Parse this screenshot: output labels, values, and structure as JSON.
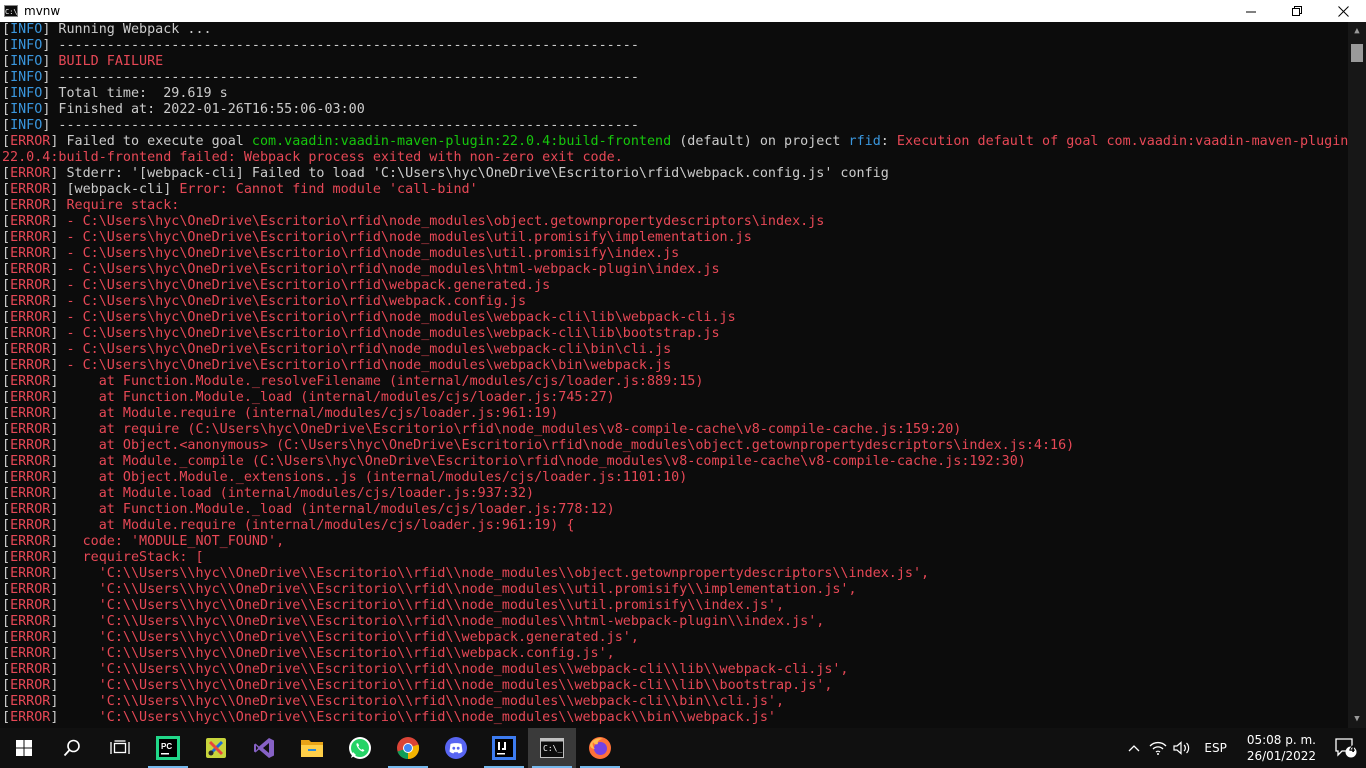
{
  "window": {
    "title": "mvnw",
    "icon_label": "C:\\"
  },
  "colors": {
    "info_tag": "#3a96dd",
    "error_tag": "#e74856",
    "default_text": "#cccccc",
    "green": "#16c60c",
    "background": "#0c0c0c",
    "taskbar": "#101010"
  },
  "terminal": {
    "lines": [
      {
        "tag": "INFO",
        "segs": [
          {
            "t": " Running Webpack ...",
            "c": "white"
          }
        ]
      },
      {
        "tag": "INFO",
        "segs": [
          {
            "t": " ------------------------------------------------------------------------",
            "c": "white"
          }
        ]
      },
      {
        "tag": "INFO",
        "segs": [
          {
            "t": " BUILD FAILURE",
            "c": "red"
          }
        ]
      },
      {
        "tag": "INFO",
        "segs": [
          {
            "t": " ------------------------------------------------------------------------",
            "c": "white"
          }
        ]
      },
      {
        "tag": "INFO",
        "segs": [
          {
            "t": " Total time:  29.619 s",
            "c": "white"
          }
        ]
      },
      {
        "tag": "INFO",
        "segs": [
          {
            "t": " Finished at: 2022-01-26T16:55:06-03:00",
            "c": "white"
          }
        ]
      },
      {
        "tag": "INFO",
        "segs": [
          {
            "t": " ------------------------------------------------------------------------",
            "c": "white"
          }
        ]
      },
      {
        "tag": "ERROR",
        "segs": [
          {
            "t": " Failed to execute goal ",
            "c": "white"
          },
          {
            "t": "com.vaadin:vaadin-maven-plugin:22.0.4:build-frontend",
            "c": "green"
          },
          {
            "t": " (default)",
            "c": "white"
          },
          {
            "t": " on project ",
            "c": "white"
          },
          {
            "t": "rfid",
            "c": "cyan"
          },
          {
            "t": ": ",
            "c": "white"
          },
          {
            "t": "Execution default of goal com.vaadin:vaadin-maven-plugin:",
            "c": "red"
          }
        ]
      },
      {
        "tag": "",
        "segs": [
          {
            "t": "22.0.4:build-frontend failed: Webpack process exited with non-zero exit code.",
            "c": "red"
          }
        ]
      },
      {
        "tag": "ERROR",
        "segs": [
          {
            "t": " Stderr: '[webpack-cli] Failed to load 'C:\\Users\\hyc\\OneDrive\\Escritorio\\rfid\\webpack.config.js' config",
            "c": "white"
          }
        ]
      },
      {
        "tag": "ERROR",
        "segs": [
          {
            "t": " [webpack-cli] ",
            "c": "white"
          },
          {
            "t": "Error: Cannot find module 'call-bind'",
            "c": "red"
          }
        ]
      },
      {
        "tag": "ERROR",
        "segs": [
          {
            "t": " Require stack:",
            "c": "red"
          }
        ]
      },
      {
        "tag": "ERROR",
        "segs": [
          {
            "t": " - C:\\Users\\hyc\\OneDrive\\Escritorio\\rfid\\node_modules\\object.getownpropertydescriptors\\index.js",
            "c": "red"
          }
        ]
      },
      {
        "tag": "ERROR",
        "segs": [
          {
            "t": " - C:\\Users\\hyc\\OneDrive\\Escritorio\\rfid\\node_modules\\util.promisify\\implementation.js",
            "c": "red"
          }
        ]
      },
      {
        "tag": "ERROR",
        "segs": [
          {
            "t": " - C:\\Users\\hyc\\OneDrive\\Escritorio\\rfid\\node_modules\\util.promisify\\index.js",
            "c": "red"
          }
        ]
      },
      {
        "tag": "ERROR",
        "segs": [
          {
            "t": " - C:\\Users\\hyc\\OneDrive\\Escritorio\\rfid\\node_modules\\html-webpack-plugin\\index.js",
            "c": "red"
          }
        ]
      },
      {
        "tag": "ERROR",
        "segs": [
          {
            "t": " - C:\\Users\\hyc\\OneDrive\\Escritorio\\rfid\\webpack.generated.js",
            "c": "red"
          }
        ]
      },
      {
        "tag": "ERROR",
        "segs": [
          {
            "t": " - C:\\Users\\hyc\\OneDrive\\Escritorio\\rfid\\webpack.config.js",
            "c": "red"
          }
        ]
      },
      {
        "tag": "ERROR",
        "segs": [
          {
            "t": " - C:\\Users\\hyc\\OneDrive\\Escritorio\\rfid\\node_modules\\webpack-cli\\lib\\webpack-cli.js",
            "c": "red"
          }
        ]
      },
      {
        "tag": "ERROR",
        "segs": [
          {
            "t": " - C:\\Users\\hyc\\OneDrive\\Escritorio\\rfid\\node_modules\\webpack-cli\\lib\\bootstrap.js",
            "c": "red"
          }
        ]
      },
      {
        "tag": "ERROR",
        "segs": [
          {
            "t": " - C:\\Users\\hyc\\OneDrive\\Escritorio\\rfid\\node_modules\\webpack-cli\\bin\\cli.js",
            "c": "red"
          }
        ]
      },
      {
        "tag": "ERROR",
        "segs": [
          {
            "t": " - C:\\Users\\hyc\\OneDrive\\Escritorio\\rfid\\node_modules\\webpack\\bin\\webpack.js",
            "c": "red"
          }
        ]
      },
      {
        "tag": "ERROR",
        "segs": [
          {
            "t": "     at Function.Module._resolveFilename (internal/modules/cjs/loader.js:889:15)",
            "c": "red"
          }
        ]
      },
      {
        "tag": "ERROR",
        "segs": [
          {
            "t": "     at Function.Module._load (internal/modules/cjs/loader.js:745:27)",
            "c": "red"
          }
        ]
      },
      {
        "tag": "ERROR",
        "segs": [
          {
            "t": "     at Module.require (internal/modules/cjs/loader.js:961:19)",
            "c": "red"
          }
        ]
      },
      {
        "tag": "ERROR",
        "segs": [
          {
            "t": "     at require (C:\\Users\\hyc\\OneDrive\\Escritorio\\rfid\\node_modules\\v8-compile-cache\\v8-compile-cache.js:159:20)",
            "c": "red"
          }
        ]
      },
      {
        "tag": "ERROR",
        "segs": [
          {
            "t": "     at Object.<anonymous> (C:\\Users\\hyc\\OneDrive\\Escritorio\\rfid\\node_modules\\object.getownpropertydescriptors\\index.js:4:16)",
            "c": "red"
          }
        ]
      },
      {
        "tag": "ERROR",
        "segs": [
          {
            "t": "     at Module._compile (C:\\Users\\hyc\\OneDrive\\Escritorio\\rfid\\node_modules\\v8-compile-cache\\v8-compile-cache.js:192:30)",
            "c": "red"
          }
        ]
      },
      {
        "tag": "ERROR",
        "segs": [
          {
            "t": "     at Object.Module._extensions..js (internal/modules/cjs/loader.js:1101:10)",
            "c": "red"
          }
        ]
      },
      {
        "tag": "ERROR",
        "segs": [
          {
            "t": "     at Module.load (internal/modules/cjs/loader.js:937:32)",
            "c": "red"
          }
        ]
      },
      {
        "tag": "ERROR",
        "segs": [
          {
            "t": "     at Function.Module._load (internal/modules/cjs/loader.js:778:12)",
            "c": "red"
          }
        ]
      },
      {
        "tag": "ERROR",
        "segs": [
          {
            "t": "     at Module.require (internal/modules/cjs/loader.js:961:19) {",
            "c": "red"
          }
        ]
      },
      {
        "tag": "ERROR",
        "segs": [
          {
            "t": "   code: 'MODULE_NOT_FOUND',",
            "c": "red"
          }
        ]
      },
      {
        "tag": "ERROR",
        "segs": [
          {
            "t": "   requireStack: [",
            "c": "red"
          }
        ]
      },
      {
        "tag": "ERROR",
        "segs": [
          {
            "t": "     'C:\\\\Users\\\\hyc\\\\OneDrive\\\\Escritorio\\\\rfid\\\\node_modules\\\\object.getownpropertydescriptors\\\\index.js',",
            "c": "red"
          }
        ]
      },
      {
        "tag": "ERROR",
        "segs": [
          {
            "t": "     'C:\\\\Users\\\\hyc\\\\OneDrive\\\\Escritorio\\\\rfid\\\\node_modules\\\\util.promisify\\\\implementation.js',",
            "c": "red"
          }
        ]
      },
      {
        "tag": "ERROR",
        "segs": [
          {
            "t": "     'C:\\\\Users\\\\hyc\\\\OneDrive\\\\Escritorio\\\\rfid\\\\node_modules\\\\util.promisify\\\\index.js',",
            "c": "red"
          }
        ]
      },
      {
        "tag": "ERROR",
        "segs": [
          {
            "t": "     'C:\\\\Users\\\\hyc\\\\OneDrive\\\\Escritorio\\\\rfid\\\\node_modules\\\\html-webpack-plugin\\\\index.js',",
            "c": "red"
          }
        ]
      },
      {
        "tag": "ERROR",
        "segs": [
          {
            "t": "     'C:\\\\Users\\\\hyc\\\\OneDrive\\\\Escritorio\\\\rfid\\\\webpack.generated.js',",
            "c": "red"
          }
        ]
      },
      {
        "tag": "ERROR",
        "segs": [
          {
            "t": "     'C:\\\\Users\\\\hyc\\\\OneDrive\\\\Escritorio\\\\rfid\\\\webpack.config.js',",
            "c": "red"
          }
        ]
      },
      {
        "tag": "ERROR",
        "segs": [
          {
            "t": "     'C:\\\\Users\\\\hyc\\\\OneDrive\\\\Escritorio\\\\rfid\\\\node_modules\\\\webpack-cli\\\\lib\\\\webpack-cli.js',",
            "c": "red"
          }
        ]
      },
      {
        "tag": "ERROR",
        "segs": [
          {
            "t": "     'C:\\\\Users\\\\hyc\\\\OneDrive\\\\Escritorio\\\\rfid\\\\node_modules\\\\webpack-cli\\\\lib\\\\bootstrap.js',",
            "c": "red"
          }
        ]
      },
      {
        "tag": "ERROR",
        "segs": [
          {
            "t": "     'C:\\\\Users\\\\hyc\\\\OneDrive\\\\Escritorio\\\\rfid\\\\node_modules\\\\webpack-cli\\\\bin\\\\cli.js',",
            "c": "red"
          }
        ]
      },
      {
        "tag": "ERROR",
        "segs": [
          {
            "t": "     'C:\\\\Users\\\\hyc\\\\OneDrive\\\\Escritorio\\\\rfid\\\\node_modules\\\\webpack\\\\bin\\\\webpack.js'",
            "c": "red"
          }
        ]
      }
    ]
  },
  "taskbar": {
    "items": [
      {
        "name": "windows-start-icon",
        "active": false,
        "running": false
      },
      {
        "name": "search-icon",
        "active": false,
        "running": false
      },
      {
        "name": "task-view-icon",
        "active": false,
        "running": false
      },
      {
        "name": "pycharm-icon",
        "active": false,
        "running": true
      },
      {
        "name": "scissors-image-app-icon",
        "active": false,
        "running": false
      },
      {
        "name": "visual-studio-icon",
        "active": false,
        "running": false
      },
      {
        "name": "file-explorer-icon",
        "active": false,
        "running": false
      },
      {
        "name": "whatsapp-icon",
        "active": false,
        "running": false
      },
      {
        "name": "chrome-icon",
        "active": false,
        "running": true
      },
      {
        "name": "discord-icon",
        "active": false,
        "running": false
      },
      {
        "name": "intellij-icon",
        "active": false,
        "running": true
      },
      {
        "name": "terminal-icon",
        "active": true,
        "running": true
      },
      {
        "name": "firefox-icon",
        "active": false,
        "running": true
      }
    ],
    "tray": {
      "language": "ESP",
      "time": "05:08 p. m.",
      "date": "26/01/2022",
      "notification_count": "4"
    }
  }
}
